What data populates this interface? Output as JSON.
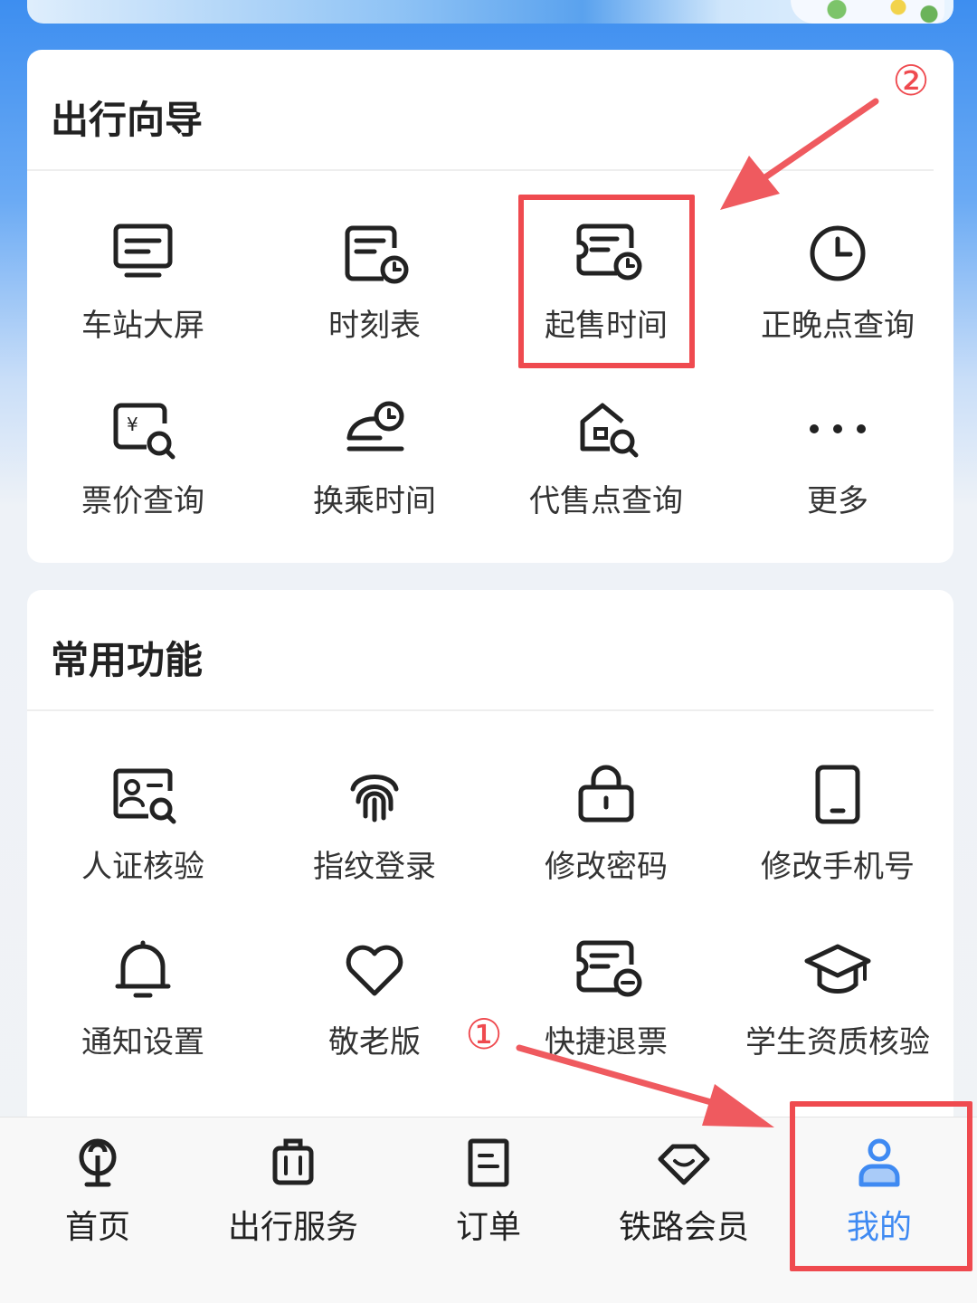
{
  "travel_guide": {
    "title": "出行向导",
    "items": [
      {
        "label": "车站大屏",
        "icon": "station-screen-icon"
      },
      {
        "label": "时刻表",
        "icon": "timetable-icon"
      },
      {
        "label": "起售时间",
        "icon": "sale-time-icon"
      },
      {
        "label": "正晚点查询",
        "icon": "clock-icon"
      },
      {
        "label": "票价查询",
        "icon": "fare-search-icon"
      },
      {
        "label": "换乘时间",
        "icon": "transfer-time-icon"
      },
      {
        "label": "代售点查询",
        "icon": "agency-search-icon"
      },
      {
        "label": "更多",
        "icon": "more-dots-icon"
      }
    ]
  },
  "common_functions": {
    "title": "常用功能",
    "items": [
      {
        "label": "人证核验",
        "icon": "id-verify-icon"
      },
      {
        "label": "指纹登录",
        "icon": "fingerprint-icon"
      },
      {
        "label": "修改密码",
        "icon": "lock-icon"
      },
      {
        "label": "修改手机号",
        "icon": "phone-icon"
      },
      {
        "label": "通知设置",
        "icon": "bell-icon"
      },
      {
        "label": "敬老版",
        "icon": "heart-icon"
      },
      {
        "label": "快捷退票",
        "icon": "refund-ticket-icon"
      },
      {
        "label": "学生资质核验",
        "icon": "graduation-cap-icon"
      }
    ]
  },
  "annotations": {
    "step1": "①",
    "step2": "②",
    "color": "#ef4a4f"
  },
  "tabbar": {
    "active_color": "#3f8af2",
    "tabs": [
      {
        "label": "首页",
        "icon": "railway-logo-icon"
      },
      {
        "label": "出行服务",
        "icon": "luggage-icon"
      },
      {
        "label": "订单",
        "icon": "order-list-icon"
      },
      {
        "label": "铁路会员",
        "icon": "diamond-icon"
      },
      {
        "label": "我的",
        "icon": "user-icon",
        "active": true
      }
    ]
  }
}
